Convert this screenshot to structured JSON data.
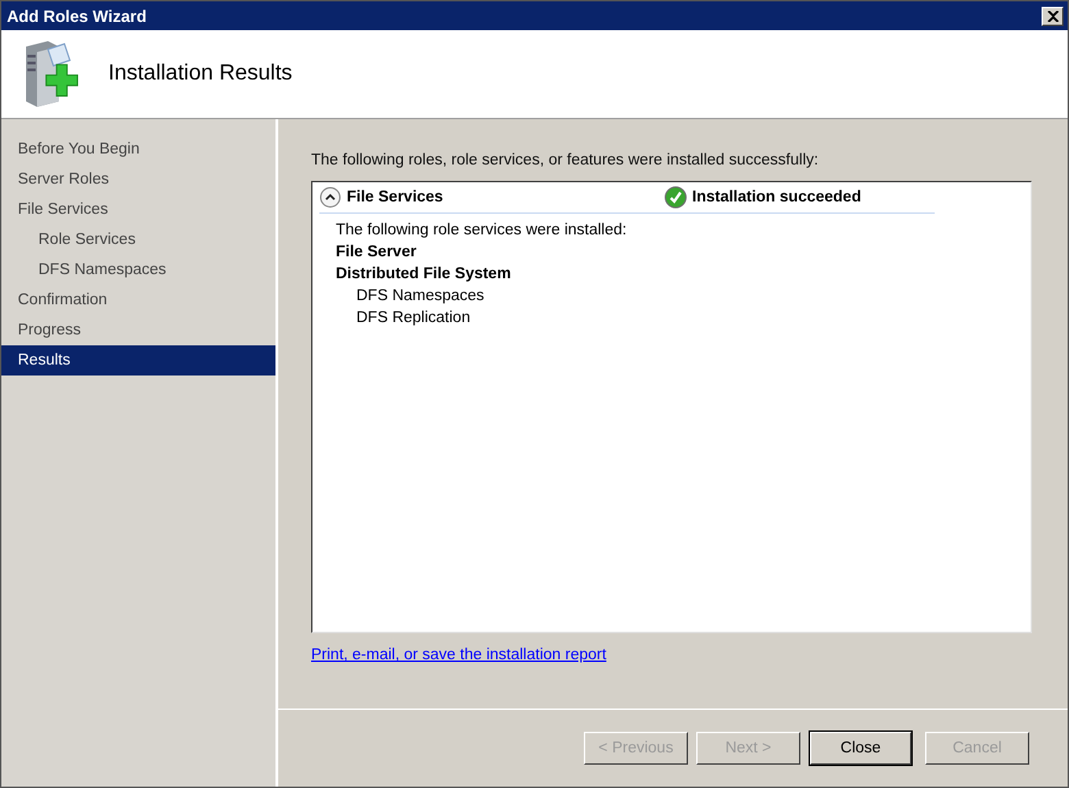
{
  "window": {
    "title": "Add Roles Wizard"
  },
  "header": {
    "title": "Installation Results"
  },
  "sidebar": {
    "items": [
      {
        "label": "Before You Begin",
        "selected": false
      },
      {
        "label": "Server Roles",
        "selected": false
      },
      {
        "label": "File Services",
        "selected": false,
        "children": [
          {
            "label": "Role Services",
            "selected": false
          },
          {
            "label": "DFS Namespaces",
            "selected": false
          }
        ]
      },
      {
        "label": "Confirmation",
        "selected": false
      },
      {
        "label": "Progress",
        "selected": false
      },
      {
        "label": "Results",
        "selected": true
      }
    ]
  },
  "content": {
    "intro": "The following roles, role services, or features were installed successfully:",
    "results": [
      {
        "name": "File Services",
        "expanded": true,
        "status": "Installation succeeded",
        "description": "The following role services were installed:",
        "services": [
          {
            "label": "File Server"
          },
          {
            "label": "Distributed File System",
            "children": [
              {
                "label": "DFS Namespaces"
              },
              {
                "label": "DFS Replication"
              }
            ]
          }
        ]
      }
    ],
    "report_link": "Print, e-mail, or save the installation report"
  },
  "buttons": [
    {
      "label": "< Previous",
      "disabled": true,
      "default": false
    },
    {
      "label": "Next >",
      "disabled": true,
      "default": false
    },
    {
      "label": "Close",
      "disabled": false,
      "default": true
    },
    {
      "label": "Cancel",
      "disabled": true,
      "default": false
    }
  ]
}
